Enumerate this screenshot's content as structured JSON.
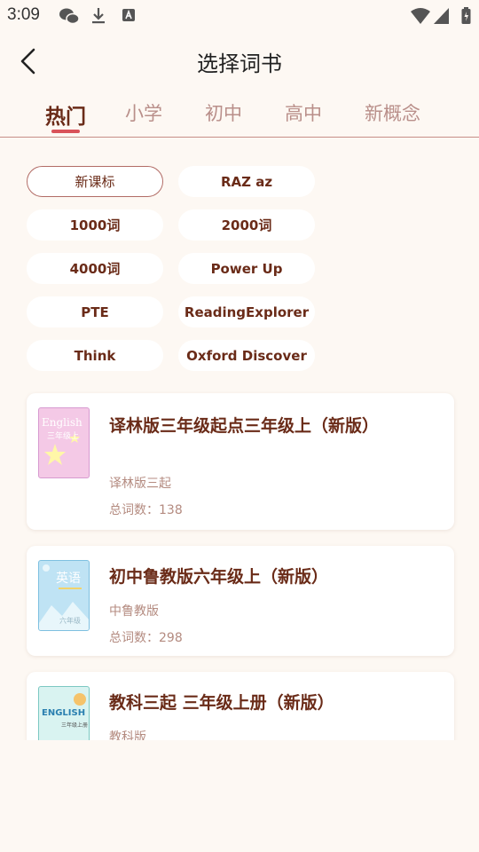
{
  "status": {
    "time": "3:09"
  },
  "header": {
    "title": "选择词书"
  },
  "tabs": [
    "热门",
    "小学",
    "初中",
    "高中",
    "新概念"
  ],
  "chips": [
    "新课标",
    "RAZ az",
    "1000词",
    "2000词",
    "4000词",
    "Power Up",
    "PTE",
    "ReadingExplorer",
    "Think",
    "Oxford Discover"
  ],
  "books": [
    {
      "title": "译林版三年级起点三年级上（新版）",
      "publisher": "译林版三起",
      "count": "总词数：138",
      "cover_text": "English",
      "cover_sub": "三年级上"
    },
    {
      "title": "初中鲁教版六年级上（新版）",
      "publisher": "中鲁教版",
      "count": "总词数：298",
      "cover_text": "英语",
      "cover_sub": "六年级"
    },
    {
      "title": "教科三起 三年级上册（新版）",
      "publisher": "教科版",
      "cover_text": "ENGLISH",
      "cover_sub": "三年级上册"
    }
  ],
  "colors": {
    "accent": "#d9535a",
    "primary_text": "#6a2b18",
    "background": "#fdf8f3"
  }
}
